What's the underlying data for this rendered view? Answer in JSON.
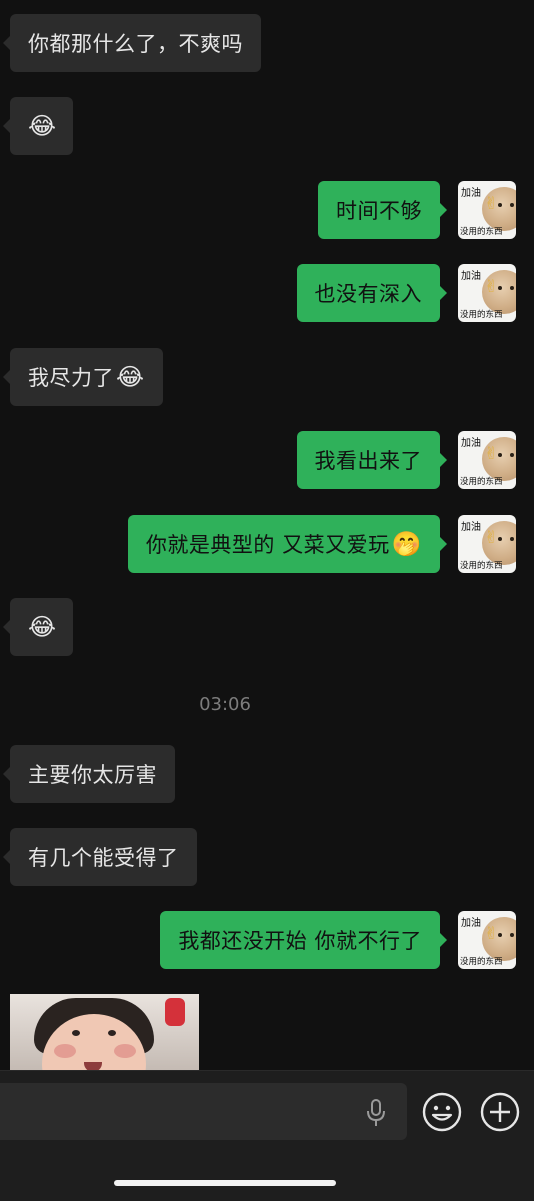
{
  "messages": [
    {
      "side": "in",
      "text": "你都那什么了，不爽吗",
      "emoji": ""
    },
    {
      "side": "in",
      "text": "",
      "emoji": "😂"
    },
    {
      "side": "out",
      "text": "时间不够",
      "emoji": ""
    },
    {
      "side": "out",
      "text": "也没有深入",
      "emoji": ""
    },
    {
      "side": "in",
      "text": "我尽力了",
      "emoji": "😂"
    },
    {
      "side": "out",
      "text": "我看出来了",
      "emoji": ""
    },
    {
      "side": "out",
      "text": "你就是典型的 又菜又爱玩",
      "emoji": "🤭"
    },
    {
      "side": "in",
      "text": "",
      "emoji": "😂"
    },
    {
      "side": "in",
      "text": "主要你太厉害",
      "emoji": ""
    },
    {
      "side": "in",
      "text": "有几个能受得了",
      "emoji": ""
    },
    {
      "side": "out",
      "text": "我都还没开始 你就不行了",
      "emoji": ""
    }
  ],
  "timestamp": "03:06",
  "avatar": {
    "line1": "加油",
    "line2": "没用的东西",
    "icon": "dog-sticker-icon"
  },
  "accent": {
    "outgoing_bubble": "#2fb15a",
    "incoming_bubble": "#2c2c2c",
    "background": "#111111"
  },
  "input_bar": {
    "text": "",
    "icons": [
      "microphone-icon",
      "emoji-icon",
      "plus-icon"
    ]
  }
}
